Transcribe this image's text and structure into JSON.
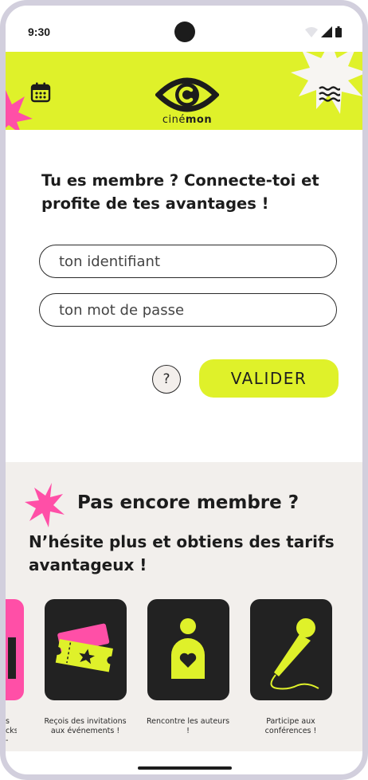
{
  "status_bar": {
    "time": "9:30"
  },
  "header": {
    "brand_prefix": "ciné",
    "brand_suffix": "mon",
    "calendar_icon": "calendar-icon",
    "menu_icon": "wave-menu-icon"
  },
  "login": {
    "title": "Tu es membre ? Connecte-toi et profite de tes avantages !",
    "username_placeholder": "ton identifiant",
    "password_placeholder": "ton mot de passe",
    "help_label": "?",
    "validate_label": "VALIDER"
  },
  "promo": {
    "title": "Pas encore membre ?",
    "subtitle": "N’hésite plus et obtiens des tarifs avantageux !",
    "cut_label": "s\ncks\n-",
    "cards": [
      {
        "icon": "tickets-icon",
        "label": "Reçois des invitations aux événements !"
      },
      {
        "icon": "person-heart-icon",
        "label": "Rencontre les auteurs !"
      },
      {
        "icon": "microphone-icon",
        "label": "Participe aux conférences !"
      }
    ]
  },
  "colors": {
    "accent": "#dff12a",
    "pink": "#ff4fa7",
    "dark": "#222222",
    "promo_bg": "#f2efec"
  }
}
